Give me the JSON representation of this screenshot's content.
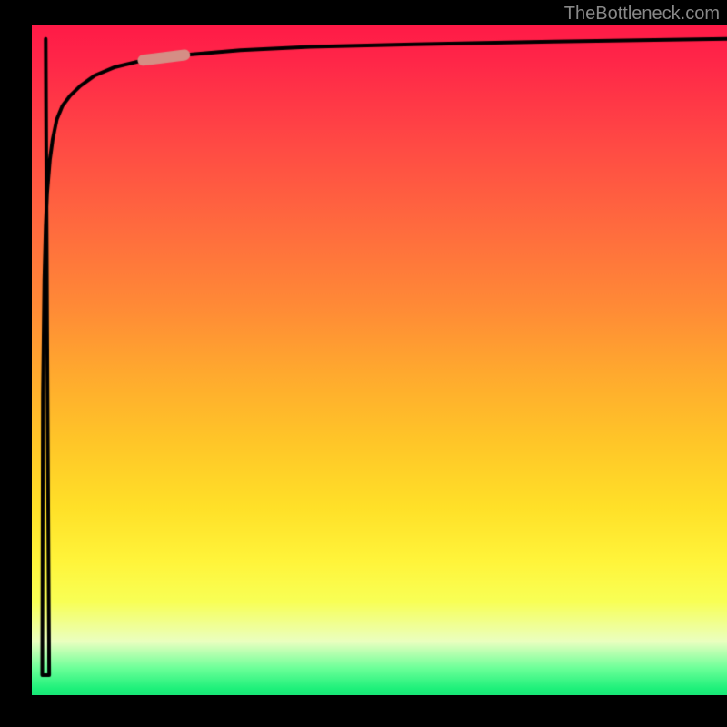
{
  "watermark": "TheBottleneck.com",
  "chart_data": {
    "type": "line",
    "title": "",
    "xlabel": "",
    "ylabel": "",
    "xlim": [
      0,
      100
    ],
    "ylim": [
      0,
      100
    ],
    "legend": false,
    "grid": false,
    "background_gradient": [
      "#ff1a47",
      "#ffa92e",
      "#fff43a",
      "#18e676"
    ],
    "series": [
      {
        "name": "bottleneck-drop-curve",
        "color": "#000000",
        "x": [
          1.5,
          1.6,
          1.8,
          2.0,
          2.2,
          2.6,
          3.0,
          3.6,
          4.4,
          5.5,
          7,
          9,
          12,
          16,
          22,
          30,
          40,
          55,
          75,
          100
        ],
        "y": [
          3,
          45,
          62,
          70,
          75,
          80,
          83,
          86,
          88,
          89.5,
          91,
          92.5,
          93.8,
          94.8,
          95.6,
          96.3,
          96.8,
          97.2,
          97.6,
          98
        ]
      },
      {
        "name": "bottleneck-initial-rise",
        "color": "#000000",
        "x": [
          2.0,
          2.2,
          2.5
        ],
        "y": [
          98,
          55,
          3
        ]
      }
    ],
    "highlight_segment": {
      "note": "small rounded light-red segment on the main curve",
      "color": "#d58e85",
      "x_range": [
        16,
        23
      ],
      "thickness": 6
    }
  }
}
